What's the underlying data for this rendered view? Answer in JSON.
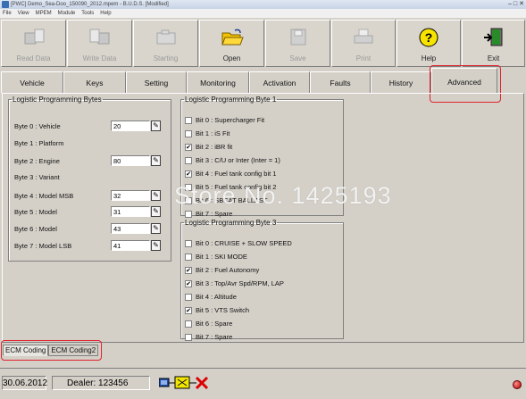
{
  "titlebar": {
    "title": "[PWC] Demo_Sea-Doo_150090_2012.mpem - B.U.D.S. [Modified]"
  },
  "menu": {
    "items": [
      "File",
      "View",
      "MPEM",
      "Module",
      "Tools",
      "Help"
    ]
  },
  "toolbar": {
    "read_data": "Read Data",
    "write_data": "Write Data",
    "starting": "Starting",
    "open": "Open",
    "save": "Save",
    "print": "Print",
    "help": "Help",
    "exit": "Exit"
  },
  "tabs": [
    "Vehicle",
    "Keys",
    "Setting",
    "Monitoring",
    "Activation",
    "Faults",
    "History",
    "Advanced"
  ],
  "left_panel": {
    "title": "Logistic Programming Bytes",
    "rows": [
      {
        "label": "Byte 0 : Vehicle",
        "value": "20"
      },
      {
        "label": "Byte 1 : Platform",
        "value": null
      },
      {
        "label": "Byte 2 : Engine",
        "value": "80"
      },
      {
        "label": "Byte 3 : Variant",
        "value": null
      },
      {
        "label": "Byte 4 : Model MSB",
        "value": "32"
      },
      {
        "label": "Byte 5 : Model",
        "value": "31"
      },
      {
        "label": "Byte 6 : Model",
        "value": "43"
      },
      {
        "label": "Byte 7 : Model LSB",
        "value": "41"
      }
    ]
  },
  "byte1_panel": {
    "title": "Logistic Programming Byte 1",
    "bits": [
      {
        "label": "Bit 0 : Supercharger Fit",
        "checked": false
      },
      {
        "label": "Bit 1 : iS Fit",
        "checked": false
      },
      {
        "label": "Bit 2 : iBR fit",
        "checked": true
      },
      {
        "label": "Bit 3 : C/U or Inter (Inter = 1)",
        "checked": false
      },
      {
        "label": "Bit 4 : Fuel tank config bit 1",
        "checked": true
      },
      {
        "label": "Bit 5 : Fuel tank config bit 2",
        "checked": false
      },
      {
        "label": "Bit 6 : SBCAT BALLAST",
        "checked": false
      },
      {
        "label": "Bit 7 : Spare",
        "checked": false
      }
    ]
  },
  "byte3_panel": {
    "title": "Logistic Programming Byte 3",
    "bits": [
      {
        "label": "Bit 0 : CRUISE + SLOW SPEED",
        "checked": false
      },
      {
        "label": "Bit 1 : SKI MODE",
        "checked": false
      },
      {
        "label": "Bit 2 : Fuel Autonomy",
        "checked": true
      },
      {
        "label": "Bit 3 : Top/Avr Spd/RPM, LAP",
        "checked": true
      },
      {
        "label": "Bit 4 : Altitude",
        "checked": false
      },
      {
        "label": "Bit 5 : VTS Switch",
        "checked": true
      },
      {
        "label": "Bit 6 : Spare",
        "checked": false
      },
      {
        "label": "Bit 7 : Spare",
        "checked": false
      }
    ]
  },
  "bottom_tabs": [
    "ECM Coding",
    "ECM Coding2"
  ],
  "status": {
    "date": "30.06.2012",
    "dealer": "Dealer: 123456"
  },
  "watermark": "Store No. 1425193",
  "colors": {
    "highlight": "#e0222b",
    "open_folder": "#f2c200",
    "help_bg": "#f7e300",
    "exit_green": "#2a8a2a"
  }
}
